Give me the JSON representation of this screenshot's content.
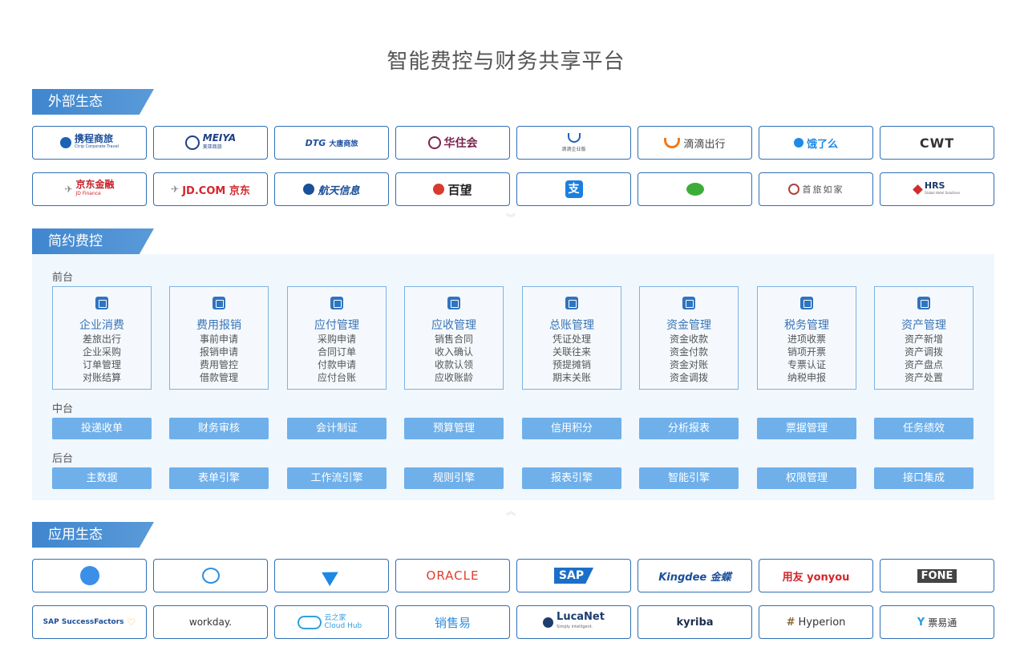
{
  "page": {
    "title": "智能费控与财务共享平台"
  },
  "sections": {
    "external": "外部生态",
    "control": "简约费控",
    "apps": "应用生态"
  },
  "external_logos": [
    [
      "携程商旅",
      "美亚商旅",
      "大唐商旅",
      "华住会",
      "滴滴企业版",
      "滴滴出行",
      "饿了么",
      "CWT"
    ],
    [
      "京东金融",
      "JD.COM 京东",
      "航天信息",
      "百望",
      "支付宝",
      "微信",
      "首旅如家",
      "HRS"
    ]
  ],
  "external_logo_sub": {
    "ctrip_sub": "Ctrip Corporate Travel",
    "meiya_sub": "美亚商旅",
    "dtg_sub": "大唐商旅",
    "jdfin_sub": "JD Finance",
    "hrs_sub": "Global Hotel Solutions"
  },
  "control": {
    "front_label": "前台",
    "middle_label": "中台",
    "back_label": "后台",
    "modules": [
      {
        "title": "企业消费",
        "items": [
          "差旅出行",
          "企业采购",
          "订单管理",
          "对账结算"
        ]
      },
      {
        "title": "费用报销",
        "items": [
          "事前申请",
          "报销申请",
          "费用管控",
          "借款管理"
        ]
      },
      {
        "title": "应付管理",
        "items": [
          "采购申请",
          "合同订单",
          "付款申请",
          "应付台账"
        ]
      },
      {
        "title": "应收管理",
        "items": [
          "销售合同",
          "收入确认",
          "收款认领",
          "应收账龄"
        ]
      },
      {
        "title": "总账管理",
        "items": [
          "凭证处理",
          "关联往来",
          "预提摊销",
          "期末关账"
        ]
      },
      {
        "title": "资金管理",
        "items": [
          "资金收款",
          "资金付款",
          "资金对账",
          "资金调拨"
        ]
      },
      {
        "title": "税务管理",
        "items": [
          "进项收票",
          "销项开票",
          "专票认证",
          "纳税申报"
        ]
      },
      {
        "title": "资产管理",
        "items": [
          "资产新增",
          "资产调拨",
          "资产盘点",
          "资产处置"
        ]
      }
    ],
    "middle": [
      "投递收单",
      "财务审核",
      "会计制证",
      "预算管理",
      "信用积分",
      "分析报表",
      "票据管理",
      "任务绩效"
    ],
    "back": [
      "主数据",
      "表单引擎",
      "工作流引擎",
      "规则引擎",
      "报表引擎",
      "智能引擎",
      "权限管理",
      "接口集成"
    ]
  },
  "app_logos": [
    [
      "钉钉",
      "企业微信",
      "飞书",
      "ORACLE",
      "SAP",
      "Kingdee 金蝶",
      "用友 yonyou",
      "FONE"
    ],
    [
      "SAP SuccessFactors",
      "workday.",
      "云之家 Cloud Hub",
      "销售易",
      "LucaNet",
      "kyriba",
      "Hyperion",
      "票易通"
    ]
  ],
  "app_logo_sub": {
    "lucanet_sub": "Simply intelligent."
  },
  "colors": {
    "accent": "#3f86cf",
    "border": "#2f6fb6",
    "pill": "#6fb0eb",
    "panel": "#f0f7fd"
  }
}
